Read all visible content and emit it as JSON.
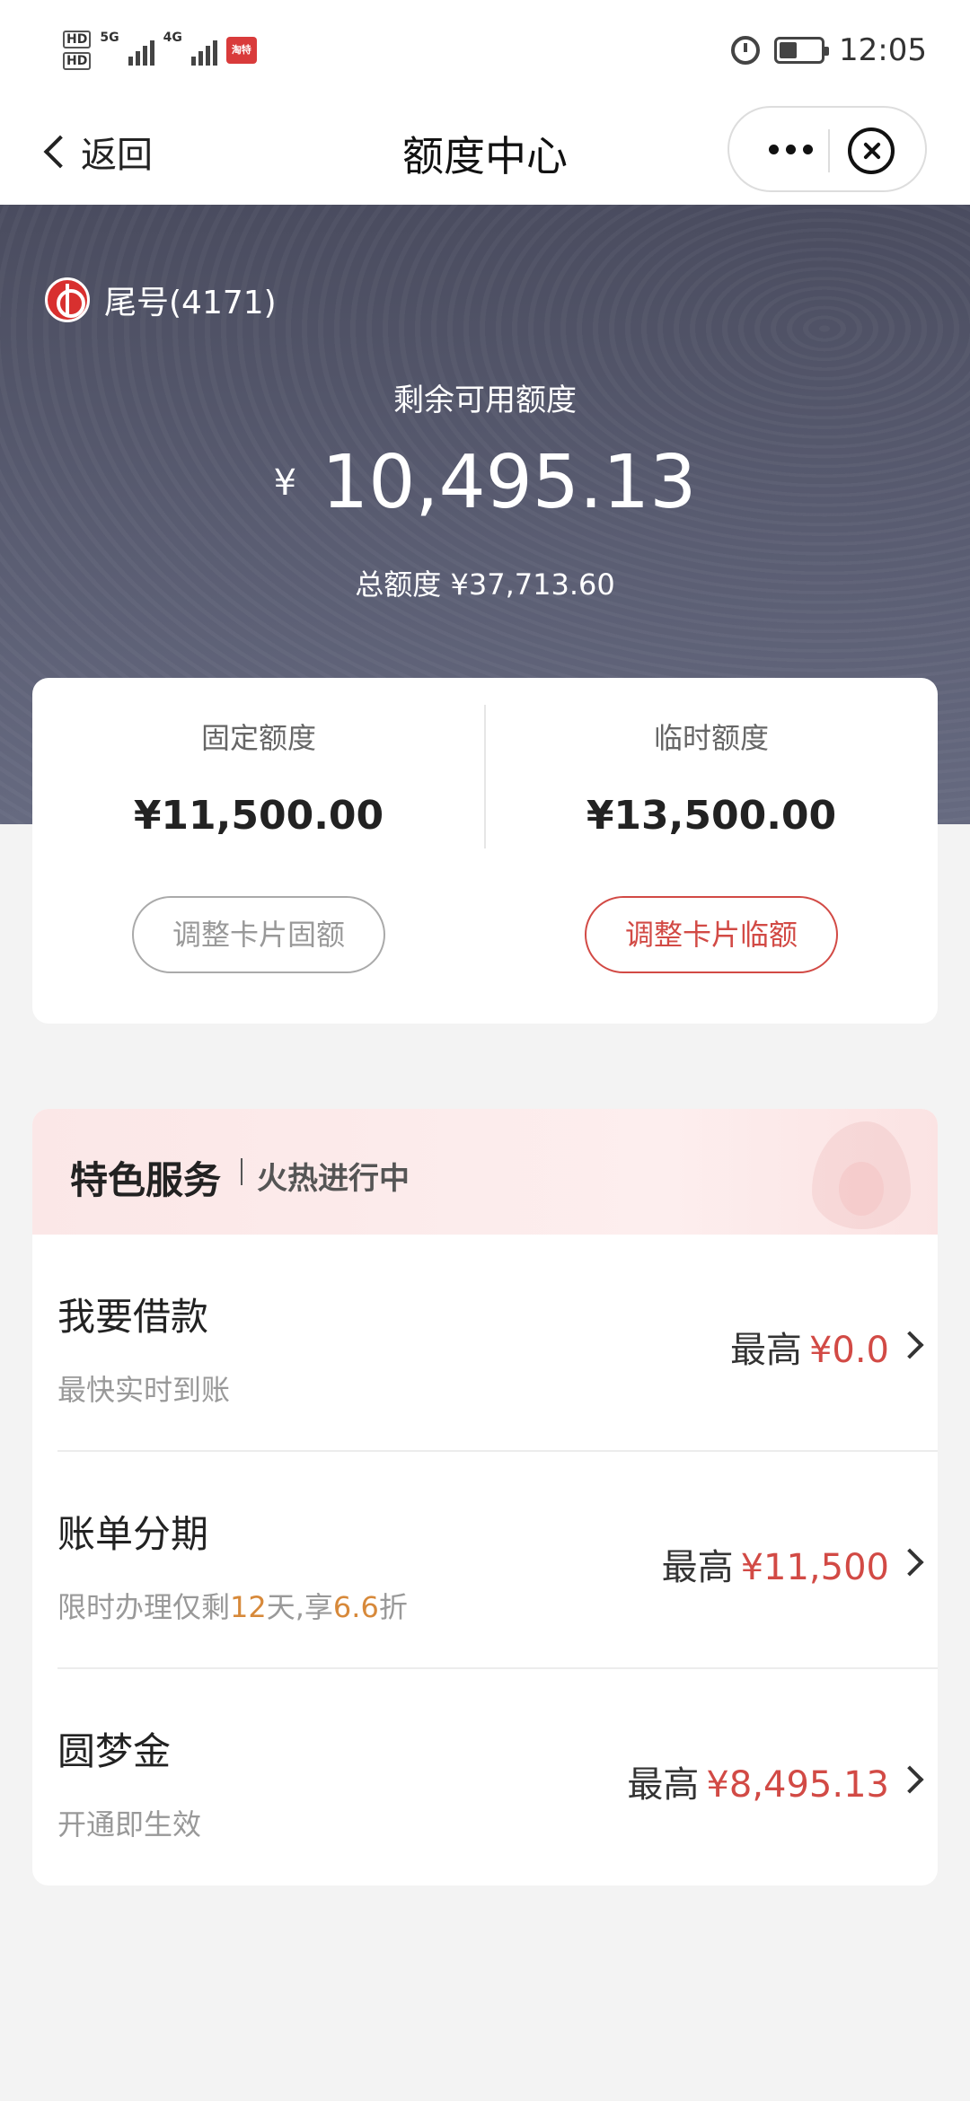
{
  "status_bar": {
    "hd1": "HD",
    "hd2": "HD",
    "net1": "5G",
    "net2": "4G",
    "app_badge": "淘特",
    "time": "12:05"
  },
  "nav": {
    "back_label": "返回",
    "title": "额度中心"
  },
  "hero": {
    "card_tail": "尾号(4171)",
    "available_label": "剩余可用额度",
    "currency": "¥",
    "available_amount": "10,495.13",
    "total_label": "总额度",
    "total_amount": "¥37,713.60"
  },
  "quota": {
    "fixed_label": "固定额度",
    "fixed_value": "¥11,500.00",
    "temp_label": "临时额度",
    "temp_value": "¥13,500.00",
    "fixed_button": "调整卡片固额",
    "temp_button": "调整卡片临额"
  },
  "services": {
    "title": "特色服务",
    "subtitle": "火热进行中",
    "max_prefix": "最高",
    "items": [
      {
        "name": "我要借款",
        "desc": "最快实时到账",
        "amount": "¥0.0"
      },
      {
        "name": "账单分期",
        "desc_a": "限时办理仅剩",
        "desc_days": "12",
        "desc_b": "天,享",
        "desc_discount": "6.6",
        "desc_c": "折",
        "amount": "¥11,500"
      },
      {
        "name": "圆梦金",
        "desc": "开通即生效",
        "amount": "¥8,495.13"
      }
    ]
  },
  "colors": {
    "accent_red": "#d24a45",
    "highlight_orange": "#d7893a",
    "hero_bg": "#555870"
  }
}
